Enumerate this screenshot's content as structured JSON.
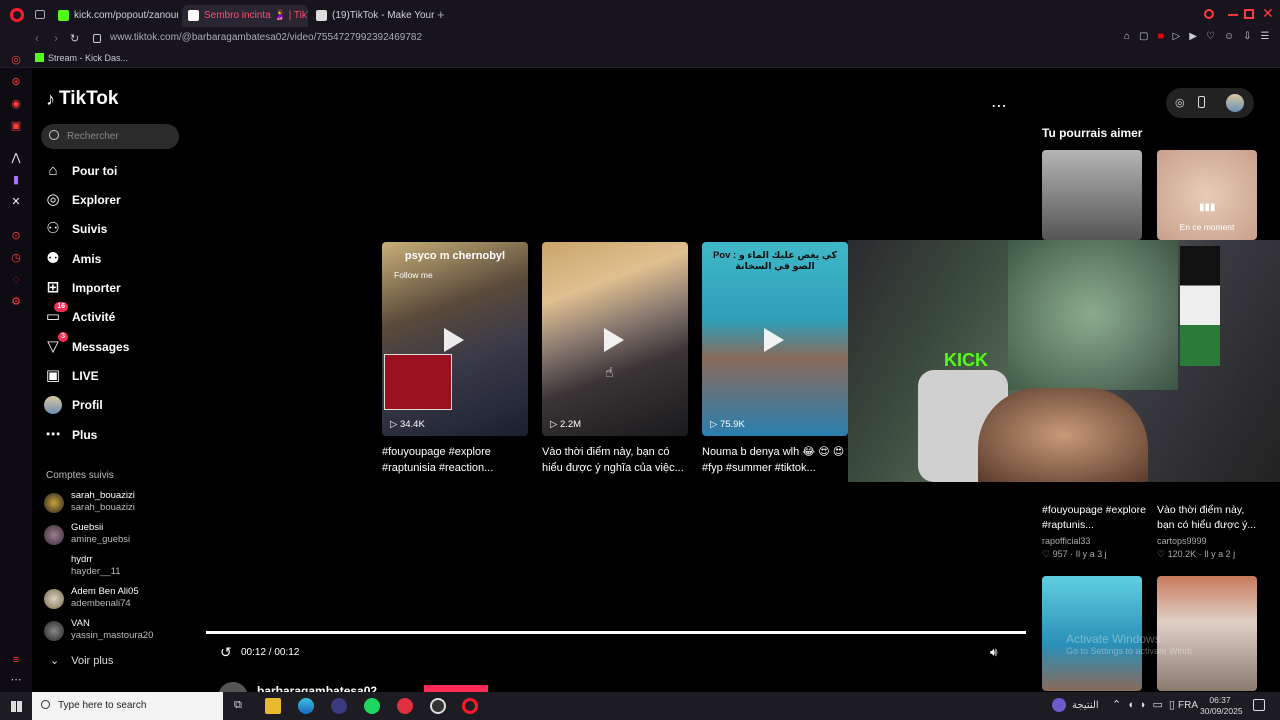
{
  "browser": {
    "tabs": [
      {
        "title": "kick.com/popout/zanouni"
      },
      {
        "title": "Sembro incinta 🤰 | TikTo"
      },
      {
        "title": "(19)TikTok - Make Your D"
      }
    ],
    "url": "www.tiktok.com/@barbaragambatesa02/video/7554727992392469782",
    "bookmark": "Stream - Kick Das..."
  },
  "tiktok": {
    "logo": "TikTok",
    "search_placeholder": "Rechercher",
    "nav": [
      {
        "label": "Pour toi",
        "icon": "home-icon"
      },
      {
        "label": "Explorer",
        "icon": "compass-icon"
      },
      {
        "label": "Suivis",
        "icon": "following-icon"
      },
      {
        "label": "Amis",
        "icon": "friends-icon"
      },
      {
        "label": "Importer",
        "icon": "upload-icon"
      },
      {
        "label": "Activité",
        "icon": "inbox-icon",
        "badge": "16"
      },
      {
        "label": "Messages",
        "icon": "messages-icon",
        "badge": "3"
      },
      {
        "label": "LIVE",
        "icon": "live-icon"
      },
      {
        "label": "Profil",
        "icon": "avatar"
      },
      {
        "label": "Plus",
        "icon": "more-icon"
      }
    ],
    "following_title": "Comptes suivis",
    "following": [
      {
        "name": "sarah_bouazizi",
        "handle": "sarah_bouazizi"
      },
      {
        "name": "Guebsii",
        "handle": "amine_guebsi"
      },
      {
        "name": "hydrr",
        "handle": "hayder__11"
      },
      {
        "name": "Adem Ben Ali05",
        "handle": "adembenali74"
      },
      {
        "name": "VAN",
        "handle": "yassin_mastoura20"
      }
    ],
    "see_more": "Voir plus",
    "videos": [
      {
        "overlay": "psyco m chernobyl",
        "sub": "Follow me",
        "views": "34.4K",
        "caption": "#fouyoupage #explore #raptunisia #reaction..."
      },
      {
        "overlay": "",
        "sub": "",
        "views": "2.2M",
        "caption": "Vào thời điểm này, bạn có hiểu được ý nghĩa của việc..."
      },
      {
        "overlay": "Pov : كي يغص عليك الماء و الصو في السخانة",
        "sub": "",
        "views": "75.9K",
        "caption": "Nouma b denya wlh 😂 😍 😍 #fyp #summer #tiktok..."
      }
    ],
    "player": {
      "time": "00:12 / 00:12",
      "author": "barbaragambatesa02"
    },
    "suggest_title": "Tu pourrais aimer",
    "live_label": "En ce moment",
    "suggest": [
      {
        "text": "#fouyoupage #explore #raptunis...",
        "user": "rapofficial33",
        "likes": "957",
        "age": "Il y a 3 j"
      },
      {
        "text": "Vào thời điểm này, bạn có hiểu được ý...",
        "user": "cartops9999",
        "likes": "120.2K",
        "age": "Il y a 2 j"
      }
    ],
    "watermark": "Activate Windows",
    "watermark_sub": "Go to Settings to activate Windows."
  },
  "stream": {
    "brand": "KICK"
  },
  "taskbar": {
    "search": "Type here to search",
    "weather": "النتيجة",
    "lang": "FRA",
    "time": "06:37",
    "date": "30/09/2025"
  },
  "colors": {
    "accent": "#fe2c55",
    "kick": "#53fc18",
    "bg": "#000000"
  }
}
